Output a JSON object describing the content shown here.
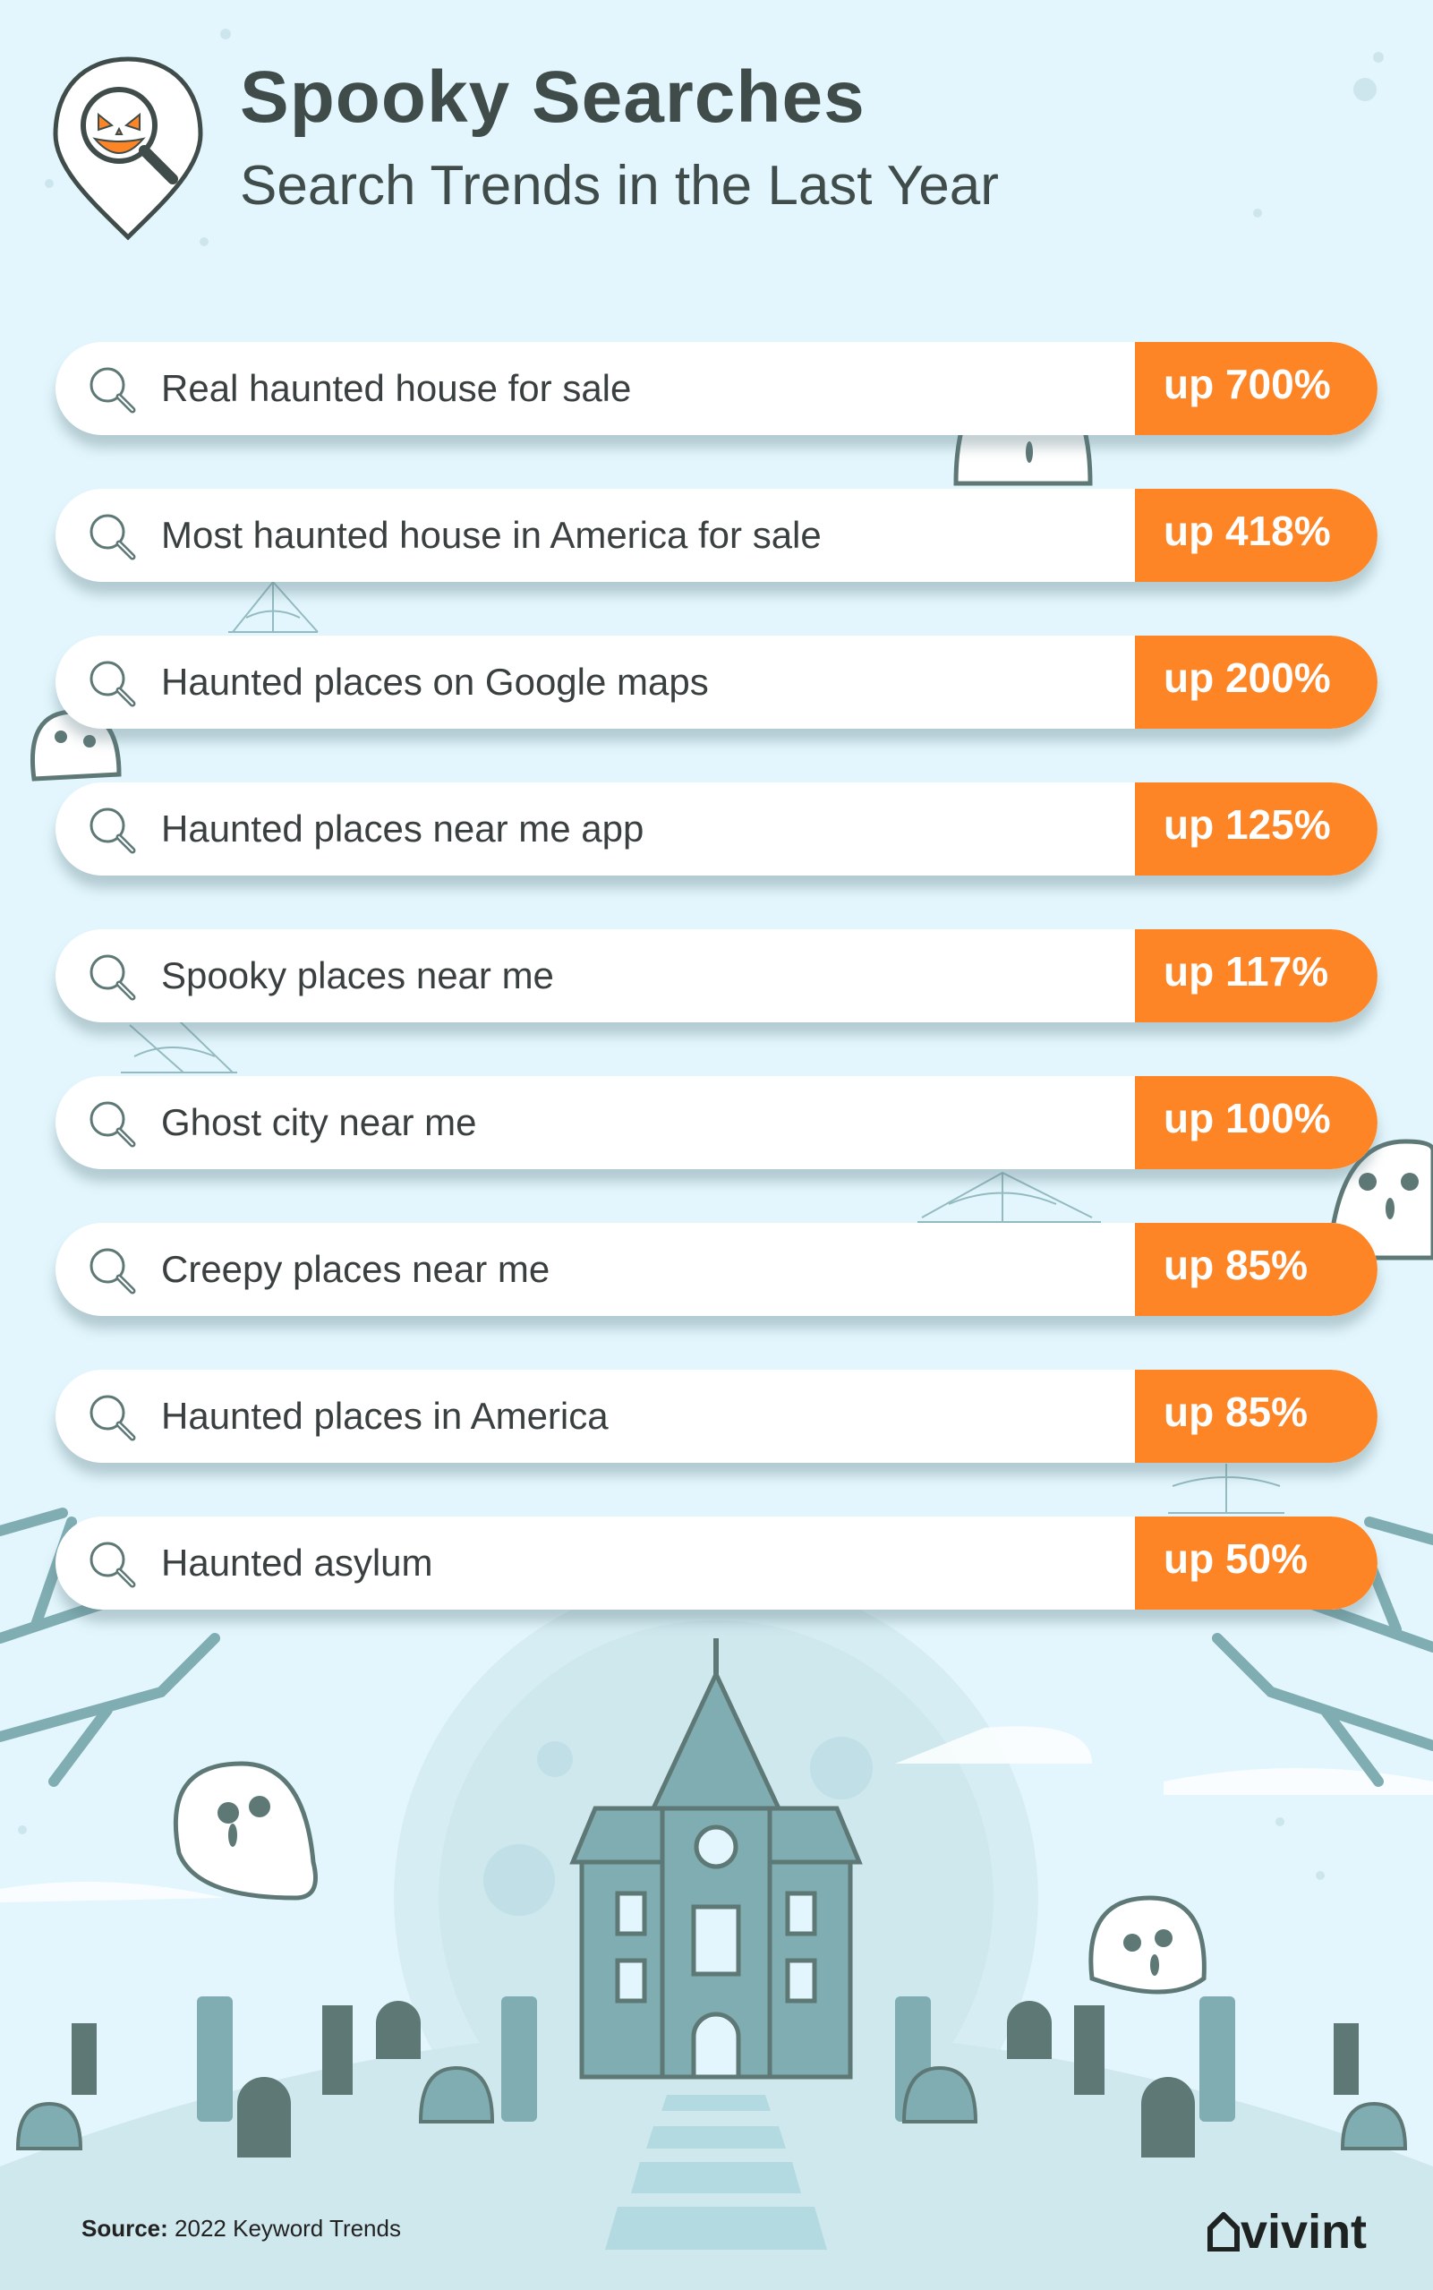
{
  "header": {
    "title": "Spooky Searches",
    "subtitle": "Search Trends in the Last Year",
    "icon": "pumpkin-magnifier-pin-icon"
  },
  "searches": [
    {
      "query": "Real haunted house for sale",
      "change": "up 700%"
    },
    {
      "query": "Most haunted house in America for sale",
      "change": "up 418%"
    },
    {
      "query": "Haunted places on Google maps",
      "change": "up 200%"
    },
    {
      "query": "Haunted places near me app",
      "change": "up 125%"
    },
    {
      "query": "Spooky places near me",
      "change": "up 117%"
    },
    {
      "query": "Ghost city near me",
      "change": "up 100%"
    },
    {
      "query": "Creepy places near me",
      "change": "up 85%"
    },
    {
      "query": "Haunted places in America",
      "change": "up 85%"
    },
    {
      "query": "Haunted asylum",
      "change": "up 50%"
    }
  ],
  "footer": {
    "source_label": "Source:",
    "source_text": "2022 Keyword Trends",
    "brand": "vivint"
  },
  "colors": {
    "background": "#e3f6fd",
    "accent": "#fd8526",
    "text": "#3f4c4a",
    "scene": "#7fadb2"
  }
}
